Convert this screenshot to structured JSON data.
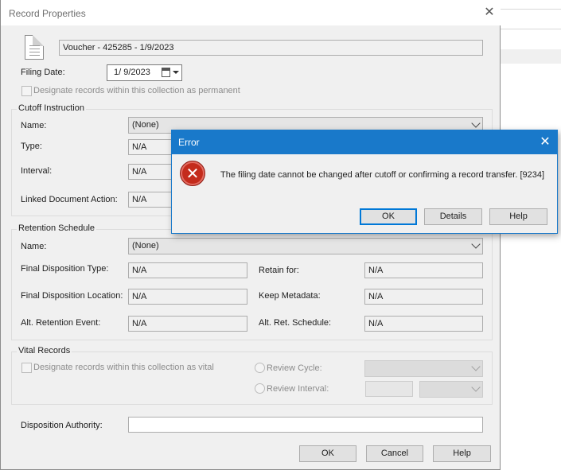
{
  "dialog": {
    "title": "Record Properties",
    "close_glyph": "✕",
    "record_name": "Voucher - 425285 - 1/9/2023",
    "filing_date_label": "Filing Date:",
    "filing_date_value": "1/ 9/2023",
    "permanent_checkbox_label": "Designate records within this collection as permanent",
    "cutoff": {
      "group_title": "Cutoff Instruction",
      "name_label": "Name:",
      "name_value": "(None)",
      "type_label": "Type:",
      "type_value": "N/A",
      "interval_label": "Interval:",
      "interval_value": "N/A",
      "linked_label": "Linked Document Action:",
      "linked_value": "N/A"
    },
    "retention": {
      "group_title": "Retention Schedule",
      "name_label": "Name:",
      "name_value": "(None)",
      "final_type_label": "Final Disposition Type:",
      "final_type_value": "N/A",
      "retain_for_label": "Retain for:",
      "retain_for_value": "N/A",
      "final_location_label": "Final Disposition Location:",
      "final_location_value": "N/A",
      "keep_metadata_label": "Keep Metadata:",
      "keep_metadata_value": "N/A",
      "alt_event_label": "Alt. Retention Event:",
      "alt_event_value": "N/A",
      "alt_schedule_label": "Alt. Ret. Schedule:",
      "alt_schedule_value": "N/A"
    },
    "vital": {
      "group_title": "Vital Records",
      "checkbox_label": "Designate records within this collection as vital",
      "review_cycle_label": "Review Cycle:",
      "review_interval_label": "Review Interval:"
    },
    "disposition_authority_label": "Disposition Authority:",
    "disposition_authority_value": "",
    "buttons": {
      "ok": "OK",
      "cancel": "Cancel",
      "help": "Help"
    }
  },
  "error_dialog": {
    "title": "Error",
    "close_glyph": "✕",
    "icon_glyph": "✕",
    "message": "The filing date cannot be changed after cutoff or confirming a record transfer. [9234]",
    "buttons": {
      "ok": "OK",
      "details": "Details",
      "help": "Help"
    }
  },
  "colors": {
    "error_titlebar": "#1979ca",
    "error_icon": "#c42b1c",
    "default_button_border": "#0078d7"
  }
}
